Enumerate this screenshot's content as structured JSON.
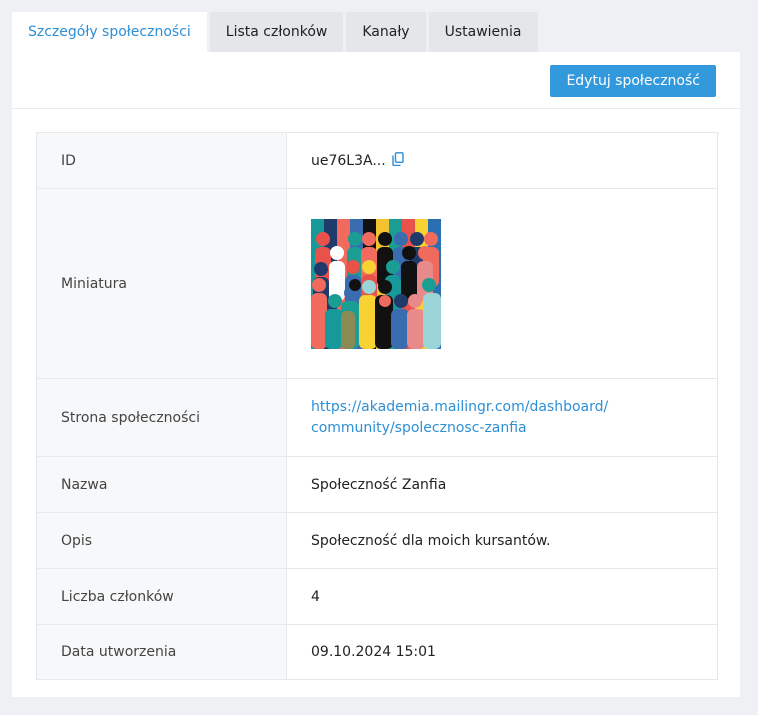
{
  "tabs": [
    {
      "label": "Szczegóły społeczności",
      "active": true
    },
    {
      "label": "Lista członków",
      "active": false
    },
    {
      "label": "Kanały",
      "active": false
    },
    {
      "label": "Ustawienia",
      "active": false
    }
  ],
  "toolbar": {
    "edit_label": "Edytuj społeczność"
  },
  "details": {
    "id": {
      "label": "ID",
      "value": "ue76L3A..."
    },
    "thumbnail": {
      "label": "Miniatura"
    },
    "page": {
      "label": "Strona społeczności",
      "url_line1": "https://akademia.mailingr.com/dashboard/",
      "url_line2": "community/spolecznosc-zanfia"
    },
    "name": {
      "label": "Nazwa",
      "value": "Społeczność Zanfia"
    },
    "description": {
      "label": "Opis",
      "value": "Społeczność dla moich kursantów."
    },
    "members": {
      "label": "Liczba członków",
      "value": "4"
    },
    "created": {
      "label": "Data utworzenia",
      "value": "09.10.2024 15:01"
    }
  },
  "colors": {
    "accent": "#2d8fd5",
    "button": "#3399dd"
  }
}
